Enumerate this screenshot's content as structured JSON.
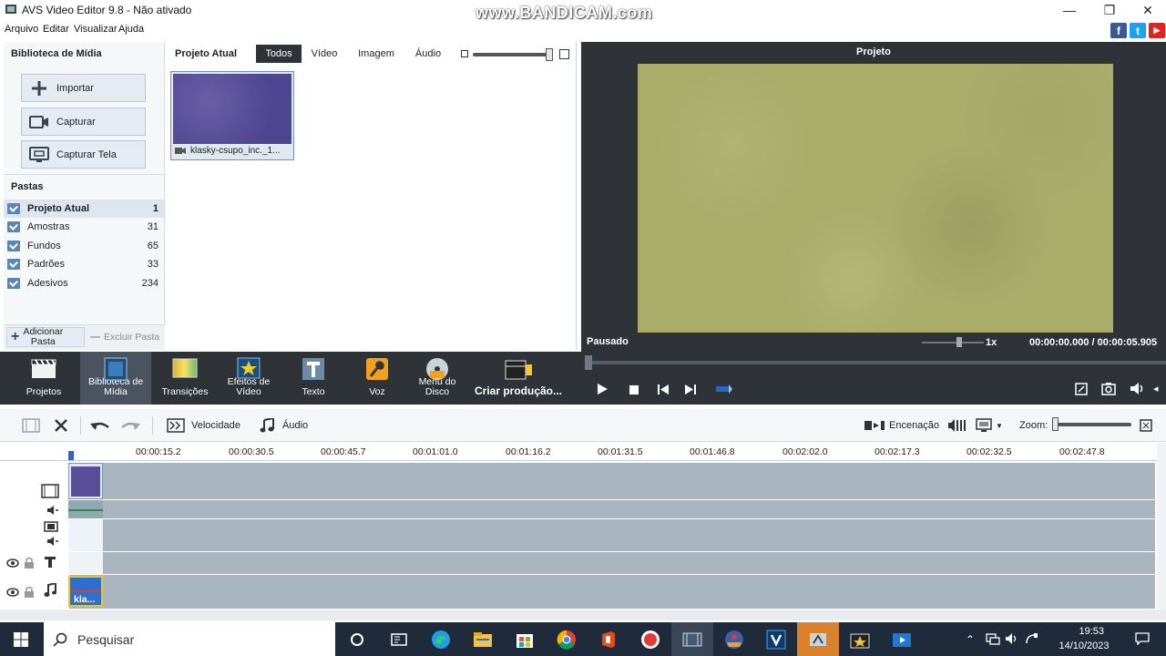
{
  "titlebar": {
    "title": "AVS Video Editor 9.8 - Não ativado",
    "watermark": "www.BANDICAM.com",
    "minimize": "—",
    "maximize": "❐",
    "close": "✕"
  },
  "menu": [
    "Arquivo",
    "Editar",
    "Visualizar",
    "Ajuda"
  ],
  "social": {
    "facebook": "f",
    "twitter": "t",
    "youtube": "▶"
  },
  "library": {
    "header": "Biblioteca de Mídia",
    "buttons": [
      {
        "label": "Importar",
        "icon": "plus-icon"
      },
      {
        "label": "Capturar",
        "icon": "camera-icon"
      },
      {
        "label": "Capturar Tela",
        "icon": "screen-icon"
      }
    ],
    "folders_header": "Pastas",
    "folders": [
      {
        "name": "Projeto Atual",
        "count": "1"
      },
      {
        "name": "Amostras",
        "count": "31"
      },
      {
        "name": "Fundos",
        "count": "65"
      },
      {
        "name": "Padrões",
        "count": "33"
      },
      {
        "name": "Adesivos",
        "count": "234"
      }
    ],
    "add_folder": "Adicionar Pasta",
    "delete_folder": "Excluir Pasta"
  },
  "media": {
    "header": "Projeto Atual",
    "tabs": [
      "Todos",
      "Vídeo",
      "Imagem",
      "Áudio"
    ],
    "active_tab": "Todos",
    "clip_name": "klasky-csupo_inc._1..."
  },
  "preview": {
    "header": "Projeto",
    "status": "Pausado",
    "speed": "1x",
    "current_time": "00:00:00.000",
    "separator": "/",
    "total_time": "00:00:05.905"
  },
  "main_toolbar": {
    "items": [
      "Projetos",
      "Biblioteca de Mídia",
      "Transições",
      "Efeitos de Vídeo",
      "Texto",
      "Voz",
      "Menu do Disco"
    ],
    "create": "Criar produção..."
  },
  "timeline_toolbar": {
    "speed": "Velocidade",
    "audio": "Áudio",
    "staging": "Encenação",
    "zoom": "Zoom:"
  },
  "ruler": [
    "00:00:15.2",
    "00:00:30.5",
    "00:00:45.7",
    "00:01:01.0",
    "00:01:16.2",
    "00:01:31.5",
    "00:01:46.8",
    "00:02:02.0",
    "00:02:17.3",
    "00:02:32.5",
    "00:02:47.8"
  ],
  "timeline": {
    "audio_clip": "kla..."
  },
  "taskbar": {
    "search": "Pesquisar",
    "time": "19:53",
    "date": "14/10/2023"
  },
  "colors": {
    "dark_panel": "#2f3338",
    "preview_frame": "#a8ad6a",
    "clip_purple": "#5a4e98",
    "track": "#a8b4be",
    "taskbar": "#1f2a3a"
  }
}
